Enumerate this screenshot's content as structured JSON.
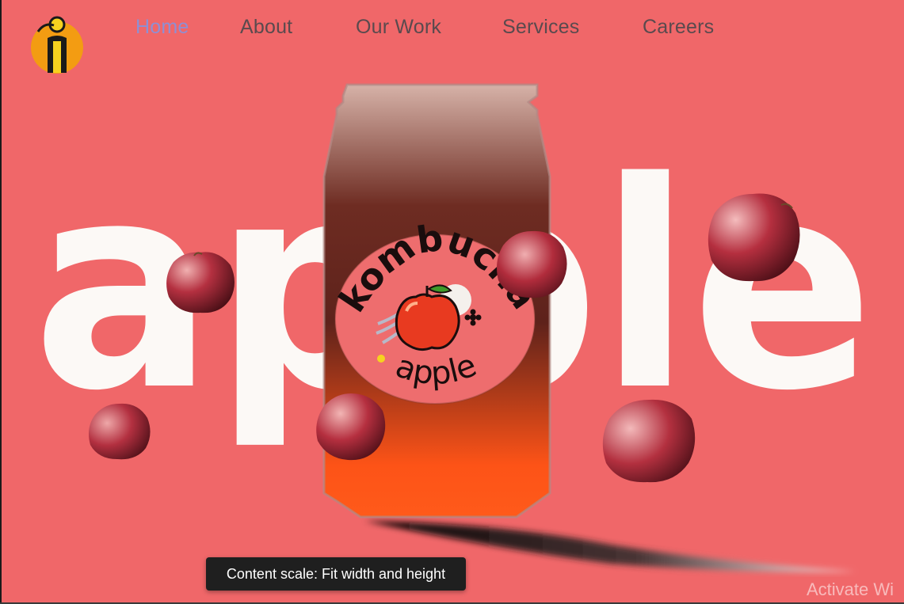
{
  "nav": {
    "items": [
      {
        "label": "Home",
        "active": true
      },
      {
        "label": "About",
        "active": false
      },
      {
        "label": "Our Work",
        "active": false
      },
      {
        "label": "Services",
        "active": false
      },
      {
        "label": "Careers",
        "active": false
      }
    ]
  },
  "logo": {
    "letter": "i",
    "icon": "logo-icon"
  },
  "hero": {
    "big_word": "apple",
    "label_top": "kombucha",
    "label_bottom": "apple"
  },
  "toast": {
    "text": "Content scale: Fit width and height"
  },
  "watermark": {
    "text": "Activate Wi"
  },
  "colors": {
    "background": "#f06769",
    "nav_active": "#8f8fd4",
    "nav_default": "#5a4a4e",
    "can_top": "#d6b2a8",
    "can_mid": "#6e2c22",
    "can_bottom": "#fd5317",
    "label_bg": "#ee6d6e",
    "logo_orange": "#f39c12",
    "logo_yellow": "#f6d21f"
  }
}
